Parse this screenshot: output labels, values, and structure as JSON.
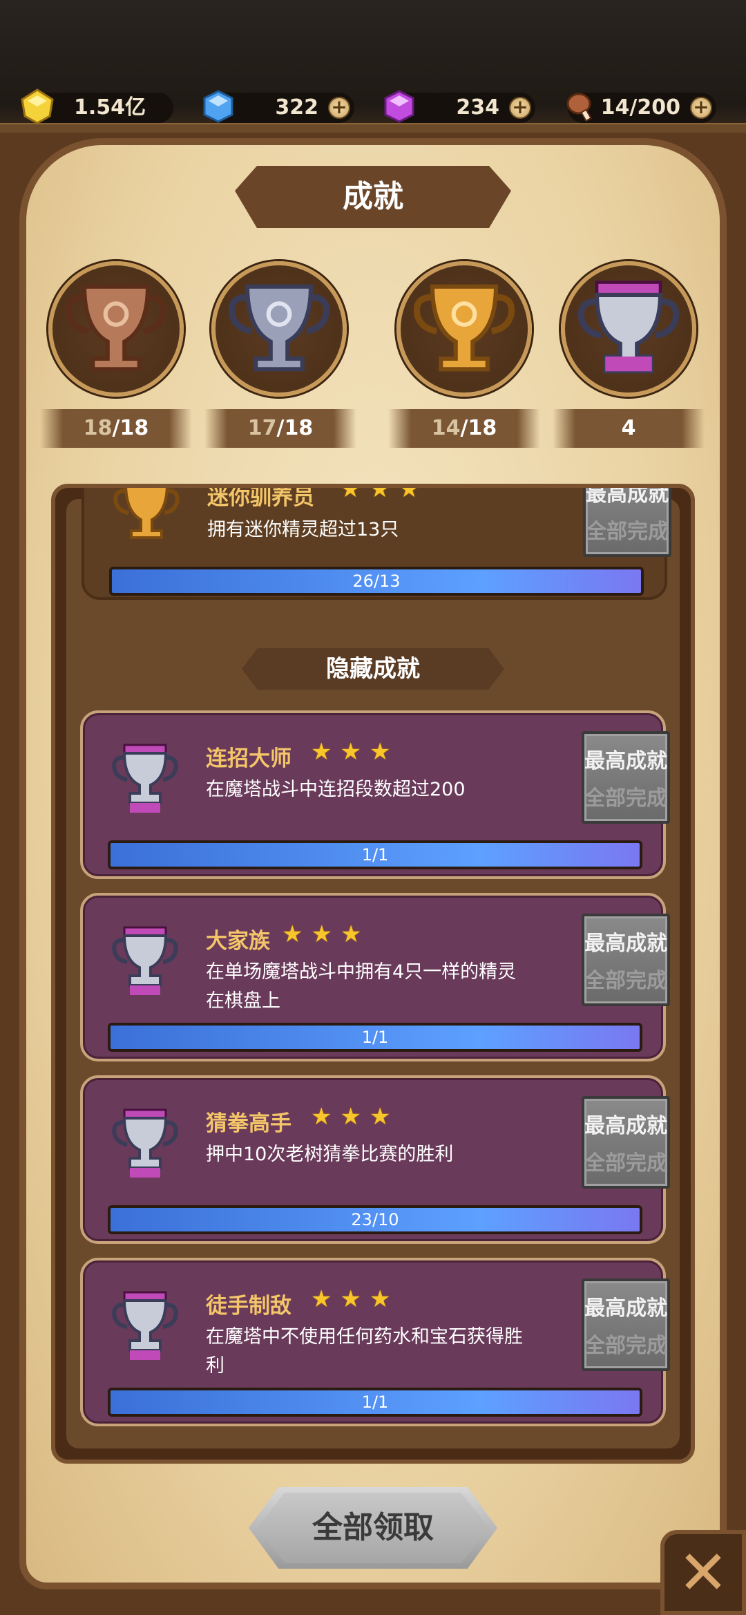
{
  "resources": [
    {
      "name": "gold",
      "value": "1.54亿",
      "icon": "gold-gem-icon",
      "color": "#f4d23a",
      "has_plus": false
    },
    {
      "name": "diamond",
      "value": "322",
      "icon": "blue-diamond-icon",
      "color": "#4fa3f0",
      "has_plus": true
    },
    {
      "name": "crystal",
      "value": "234",
      "icon": "purple-crystal-icon",
      "color": "#c24be0",
      "has_plus": true
    },
    {
      "name": "stamina",
      "value": "14/200",
      "icon": "meat-icon",
      "color": "#b0603a",
      "has_plus": true
    }
  ],
  "title": "成就",
  "trophies": [
    {
      "kind": "bronze",
      "icon": "bronze-trophy-icon",
      "done": "18",
      "total": "/18"
    },
    {
      "kind": "silver",
      "icon": "silver-trophy-icon",
      "done": "17",
      "total": "/18"
    },
    {
      "kind": "gold",
      "icon": "gold-trophy-icon",
      "done": "14",
      "total": "/18"
    },
    {
      "kind": "platinum",
      "icon": "platinum-trophy-icon",
      "done": "",
      "total": "4"
    }
  ],
  "list": {
    "top_card": {
      "name": "迷你驯养员",
      "desc": "拥有迷你精灵超过13只",
      "progress_text": "26/13",
      "progress": 1.0,
      "btn_top": "最高成就",
      "btn_bottom": "全部完成"
    },
    "hidden_header": "隐藏成就",
    "cards": [
      {
        "name": "连招大师",
        "desc": "在魔塔战斗中连招段数超过200",
        "progress_text": "1/1",
        "progress": 1.0,
        "btn_top": "最高成就",
        "btn_bottom": "全部完成"
      },
      {
        "name": "大家族",
        "desc": "在单场魔塔战斗中拥有4只一样的精灵在棋盘上",
        "progress_text": "1/1",
        "progress": 1.0,
        "btn_top": "最高成就",
        "btn_bottom": "全部完成"
      },
      {
        "name": "猜拳高手",
        "desc": "押中10次老树猜拳比赛的胜利",
        "progress_text": "23/10",
        "progress": 1.0,
        "btn_top": "最高成就",
        "btn_bottom": "全部完成"
      },
      {
        "name": "徒手制敌",
        "desc": "在魔塔中不使用任何药水和宝石获得胜利",
        "progress_text": "1/1",
        "progress": 1.0,
        "btn_top": "最高成就",
        "btn_bottom": "全部完成"
      }
    ],
    "stars": "★★★"
  },
  "claim_all": "全部领取",
  "close_icon": "close-x-icon"
}
